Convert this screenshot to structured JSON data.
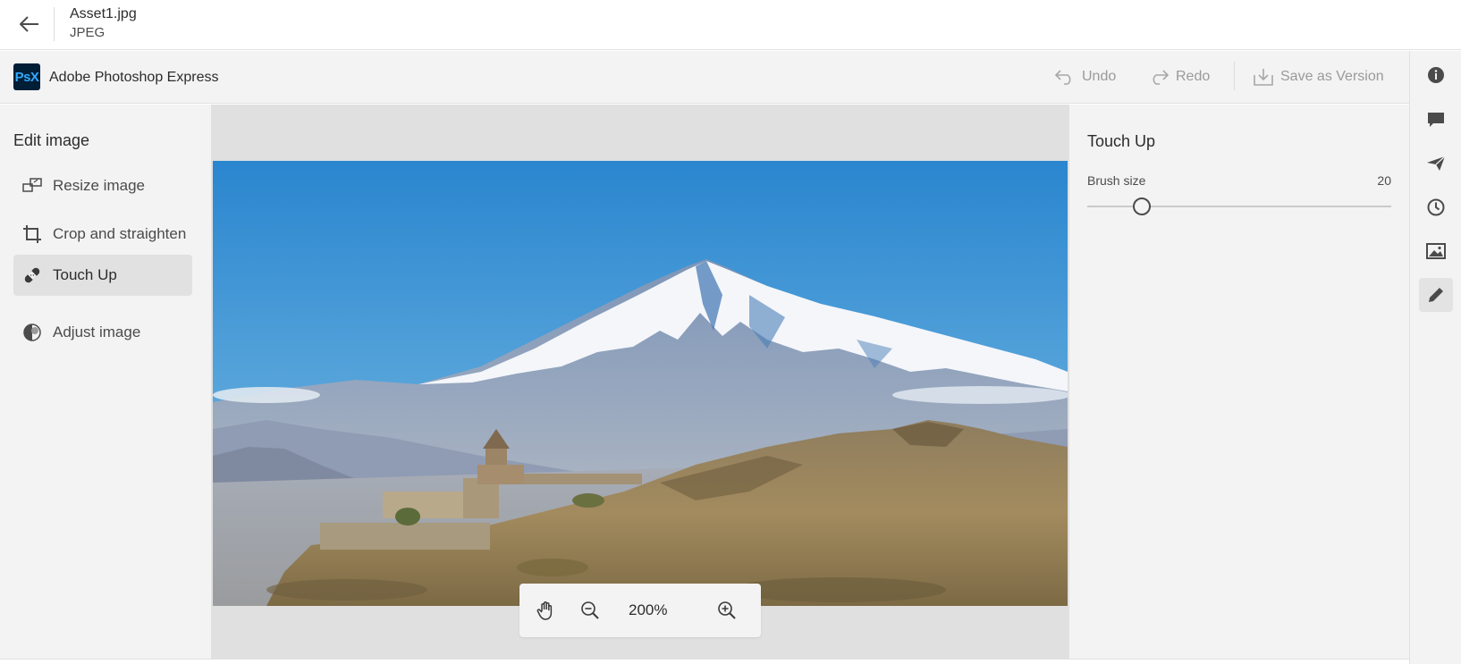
{
  "file": {
    "name": "Asset1.jpg",
    "type": "JPEG"
  },
  "app": {
    "logo_text": "PsX",
    "name": "Adobe Photoshop Express",
    "brand_color": "#001e36",
    "logo_accent": "#31a8ff"
  },
  "actions": {
    "undo": "Undo",
    "redo": "Redo",
    "save_version": "Save as Version"
  },
  "left_panel": {
    "title": "Edit image",
    "tools": [
      {
        "label": "Resize image",
        "icon": "resize-icon"
      },
      {
        "label": "Crop and straighten",
        "icon": "crop-icon"
      },
      {
        "label": "Touch Up",
        "icon": "bandage-icon",
        "active": true
      },
      {
        "label": "Adjust image",
        "icon": "adjust-icon"
      }
    ]
  },
  "zoom": {
    "level": "200%"
  },
  "properties": {
    "title": "Touch Up",
    "brush_size_label": "Brush size",
    "brush_size_value": "20",
    "brush_size_fraction": 0.18
  },
  "right_rail": [
    "info-icon",
    "comment-icon",
    "send-icon",
    "history-icon",
    "image-icon",
    "edit-icon"
  ]
}
